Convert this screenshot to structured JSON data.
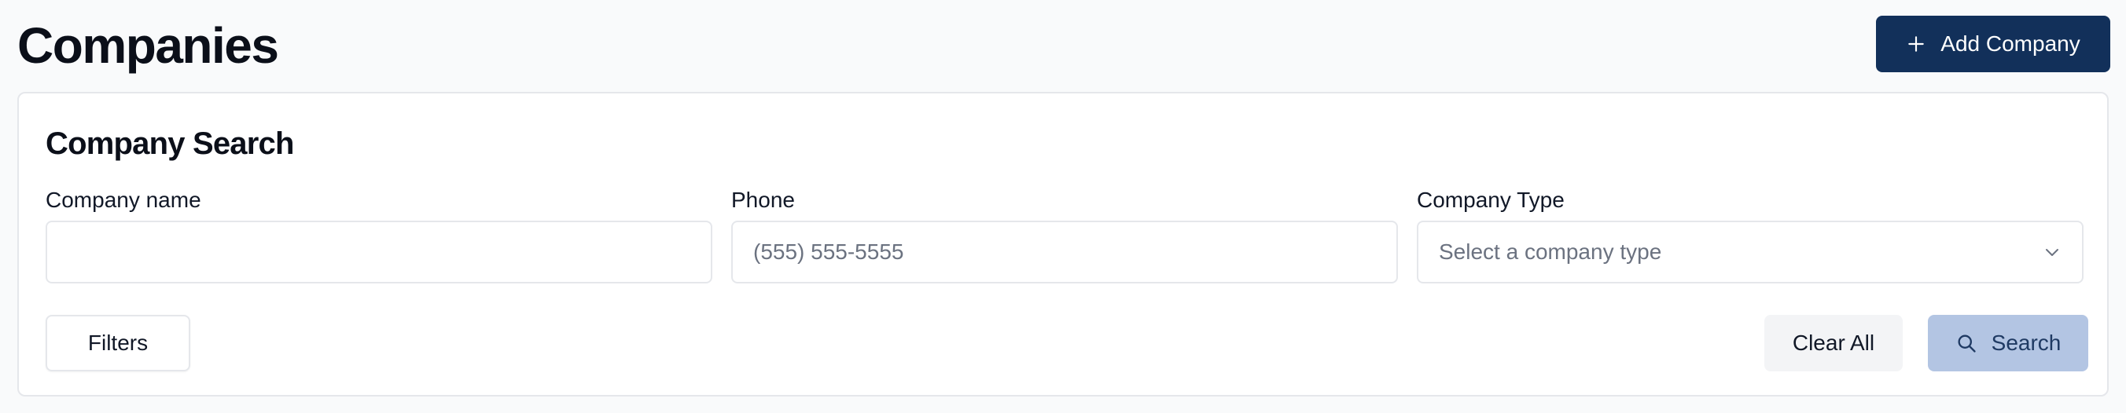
{
  "header": {
    "title": "Companies",
    "add_button_label": "Add Company",
    "add_button_icon": "plus-icon",
    "accent": "#12305a"
  },
  "search_card": {
    "title": "Company Search",
    "fields": {
      "company_name": {
        "label": "Company name",
        "value": "",
        "placeholder": ""
      },
      "phone": {
        "label": "Phone",
        "value": "",
        "placeholder": "(555) 555-5555"
      },
      "company_type": {
        "label": "Company Type",
        "placeholder": "Select a company type",
        "icon": "chevron-down-icon"
      }
    },
    "actions": {
      "filters_label": "Filters",
      "clear_label": "Clear All",
      "search_label": "Search",
      "search_icon": "search-icon",
      "search_color": "#b3c5e3"
    }
  }
}
